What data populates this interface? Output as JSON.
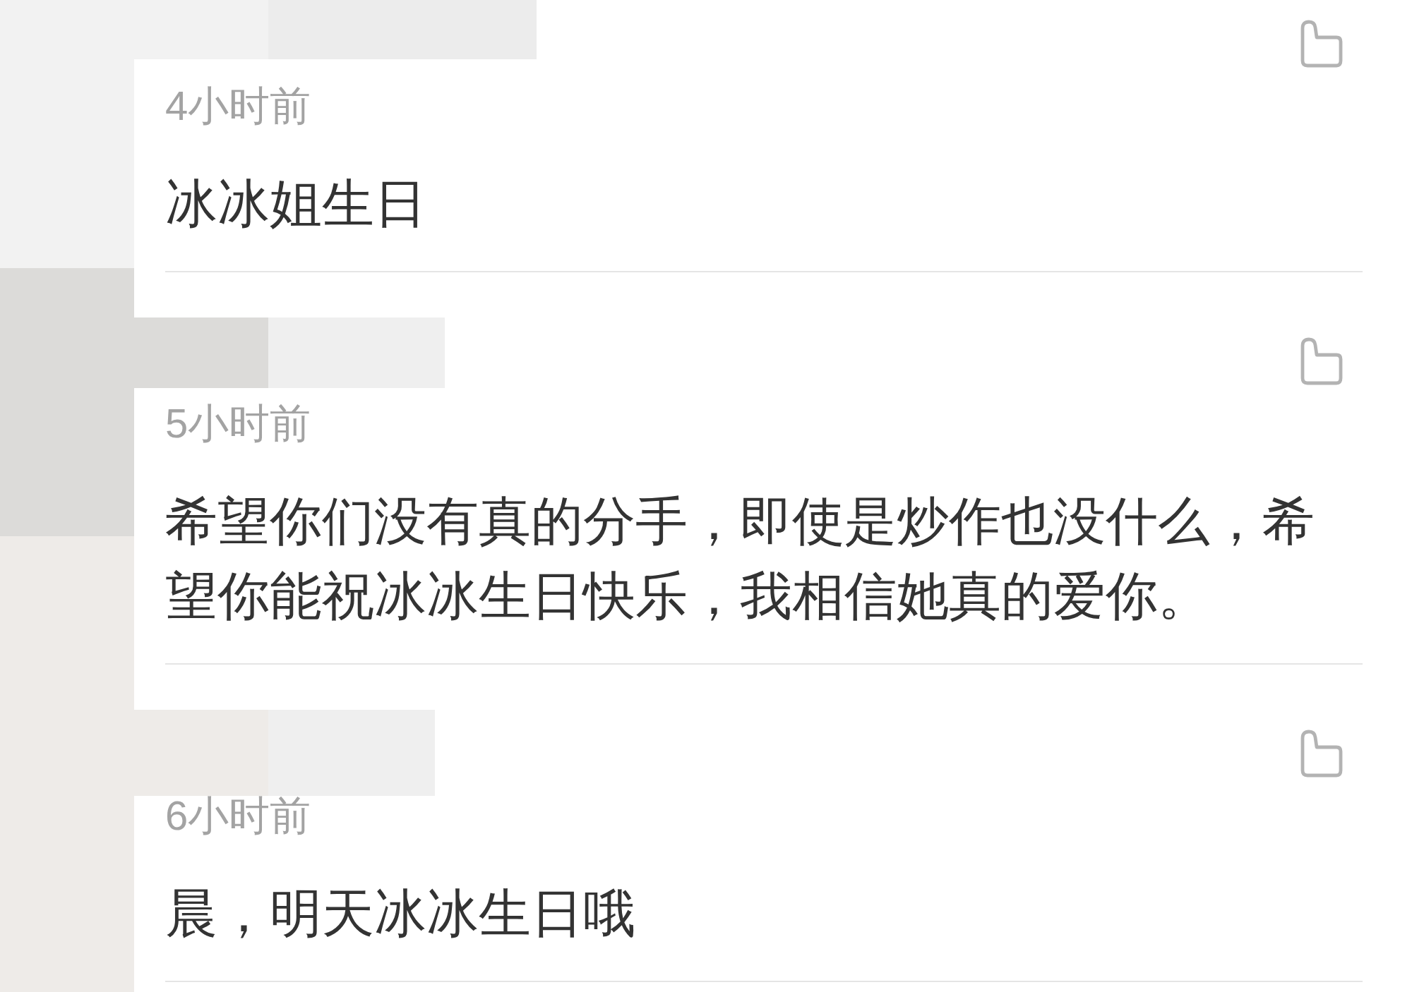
{
  "comments": [
    {
      "time": "4小时前",
      "text": "冰冰姐生日"
    },
    {
      "time": "5小时前",
      "text": "希望你们没有真的分手，即使是炒作也没什么，希望你能祝冰冰生日快乐，我相信她真的爱你。"
    },
    {
      "time": "6小时前",
      "text": "晨，明天冰冰生日哦"
    }
  ]
}
